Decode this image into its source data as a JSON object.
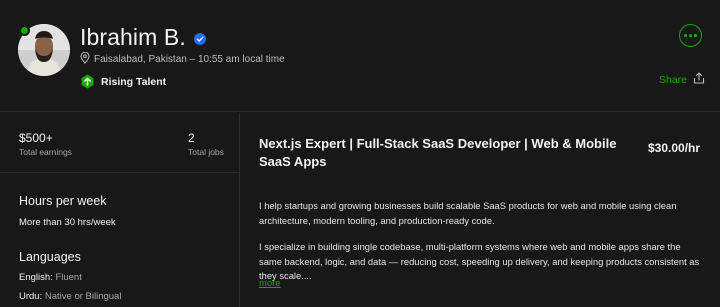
{
  "profile": {
    "name": "Ibrahim B.",
    "location": "Faisalabad, Pakistan – 10:55 am local time",
    "badge": "Rising Talent",
    "share_label": "Share"
  },
  "stats": {
    "earnings_value": "$500+",
    "earnings_label": "Total earnings",
    "jobs_value": "2",
    "jobs_label": "Total jobs"
  },
  "hours": {
    "title": "Hours per week",
    "value": "More than 30 hrs/week"
  },
  "languages": {
    "title": "Languages",
    "items": [
      {
        "name": "English:",
        "level": "Fluent"
      },
      {
        "name": "Urdu:",
        "level": "Native or Bilingual"
      }
    ]
  },
  "main": {
    "title": "Next.js Expert | Full-Stack SaaS Developer | Web & Mobile SaaS Apps",
    "rate": "$30.00/hr",
    "paragraph1": "I help startups and growing businesses build scalable SaaS products for web and mobile using clean architecture, modern tooling, and production-ready code.",
    "paragraph2": "I specialize in building single codebase, multi-platform systems where web and mobile apps share the same backend, logic, and data — reducing cost, speeding up delivery, and keeping products consistent as they scale....",
    "more_label": "more"
  },
  "colors": {
    "background": "#181818",
    "accent": "#14a800",
    "verified": "#1f6ff5",
    "divider": "#2c2c2c"
  },
  "icons": [
    "online-status-icon",
    "verified-icon",
    "location-pin-icon",
    "rising-talent-icon",
    "more-options-icon",
    "share-icon"
  ]
}
